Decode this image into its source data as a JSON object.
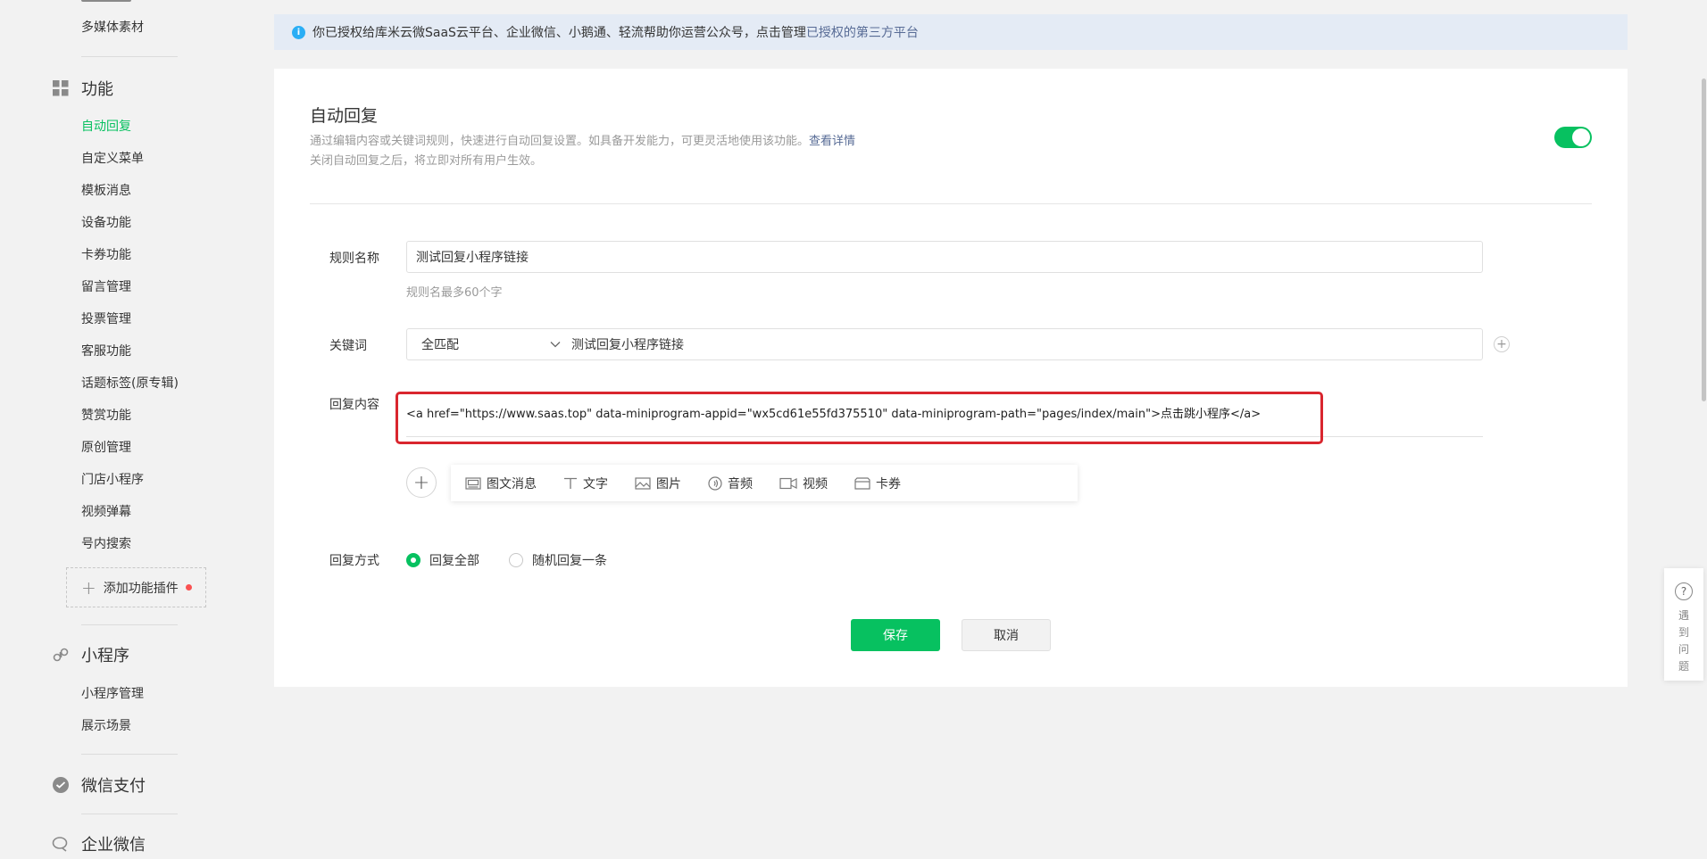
{
  "sidebar": {
    "top_item": "多媒体素材",
    "sections": [
      {
        "title": "功能",
        "icon": "grid-icon",
        "items": [
          "自动回复",
          "自定义菜单",
          "模板消息",
          "设备功能",
          "卡券功能",
          "留言管理",
          "投票管理",
          "客服功能",
          "话题标签(原专辑)",
          "赞赏功能",
          "原创管理",
          "门店小程序",
          "视频弹幕",
          "号内搜索"
        ],
        "active_index": 0,
        "add_plugin_label": "添加功能插件"
      },
      {
        "title": "小程序",
        "icon": "miniprogram-icon",
        "items": [
          "小程序管理",
          "展示场景"
        ]
      },
      {
        "title": "微信支付",
        "icon": "wechat-pay-icon"
      },
      {
        "title": "企业微信",
        "icon": "work-wechat-icon"
      }
    ]
  },
  "notice": {
    "text": "你已授权给库米云微SaaS云平台、企业微信、小鹅通、轻流帮助你运营公众号，点击管理",
    "link": "已授权的第三方平台"
  },
  "page": {
    "title": "自动回复",
    "desc_line1": "通过编辑内容或关键词规则，快速进行自动回复设置。如具备开发能力，可更灵活地使用该功能。",
    "desc_link": "查看详情",
    "desc_line2": "关闭自动回复之后，将立即对所有用户生效。",
    "enabled": true
  },
  "form": {
    "rule_name_label": "规则名称",
    "rule_name_value": "测试回复小程序链接",
    "rule_name_hint": "规则名最多60个字",
    "keyword_label": "关键词",
    "keyword_match": "全匹配",
    "keyword_value": "测试回复小程序链接",
    "reply_label": "回复内容",
    "reply_value": "<a href=\"https://www.saas.top\" data-miniprogram-appid=\"wx5cd61e55fd375510\" data-miniprogram-path=\"pages/index/main\">点击跳小程序</a>",
    "media_types": [
      "图文消息",
      "文字",
      "图片",
      "音频",
      "视频",
      "卡券"
    ],
    "reply_mode_label": "回复方式",
    "reply_mode_options": [
      "回复全部",
      "随机回复一条"
    ],
    "reply_mode_selected": 0,
    "save_label": "保存",
    "cancel_label": "取消"
  },
  "help": {
    "label": "遇到问题"
  },
  "colors": {
    "accent": "#07c160",
    "link": "#576b95",
    "highlight_box": "#d9262e",
    "notice_bg": "#e4ebf5"
  }
}
